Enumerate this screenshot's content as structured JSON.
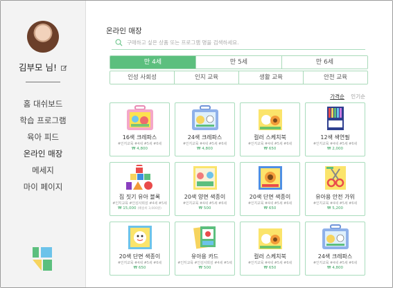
{
  "sidebar": {
    "username": "김부모 님!",
    "nav": [
      "홈 대쉬보드",
      "학습 프로그램",
      "육아 피드",
      "온라인 매장",
      "메세지",
      "마이 페이지"
    ],
    "active_nav": "온라인 매장"
  },
  "main": {
    "title": "온라인 매장",
    "search_placeholder": "구매하고 싶은 상품 또는 프로그램 명을 검색하세요.",
    "age_tabs": [
      "만 4세",
      "만 5세",
      "만 6세"
    ],
    "selected_age": "만 4세",
    "category_tabs": [
      "인성 사회성",
      "인지 교육",
      "생활 교육",
      "안전 교육"
    ],
    "sort_options": [
      "가격순",
      "인기순"
    ],
    "selected_sort": "가격순"
  },
  "products": [
    {
      "name": "16색 크레파스",
      "tags": "#인지교육 #4세 #5세 #6세",
      "price": "₩ 4,800",
      "image": "pink-crayon-case"
    },
    {
      "name": "24색 크레파스",
      "tags": "#인지교육 #4세 #5세 #6세",
      "price": "₩ 4,800",
      "image": "blue-crayon-case"
    },
    {
      "name": "컬러 스케치북",
      "tags": "#인지교육 #4세 #5세 #6세",
      "price": "₩ 650",
      "image": "sketchbook"
    },
    {
      "name": "12색 색연필",
      "tags": "#인지교육 #4세 #5세 #6세",
      "price": "₩ 2,000",
      "image": "color-pencils"
    },
    {
      "name": "집 짓기 유아 블록",
      "tags": "#인지교육 #인성사회성 #4세 #5세",
      "price": "₩ 15,000",
      "price_note": "(배송비 3,000원)",
      "image": "toy-blocks"
    },
    {
      "name": "20색 양면 색종이",
      "tags": "#인지교육 #4세 #5세 #6세",
      "price": "₩ 500",
      "image": "paper-pack"
    },
    {
      "name": "20색 단면 색종이",
      "tags": "#인지교육 #4세 #5세 #6세",
      "price": "₩ 650",
      "image": "paper-pack-blue"
    },
    {
      "name": "유아용 안전 가위",
      "tags": "#인지교육 #4세 #5세 #6세",
      "price": "₩ 5,200",
      "image": "safety-scissors"
    },
    {
      "name": "20색 단면 색종이",
      "tags": "#인지교육 #4세 #5세 #6세",
      "price": "₩ 650",
      "image": "paper-pack-yellow"
    },
    {
      "name": "유아용 카드",
      "tags": "#인지교육 #인성사회성 #4세 #5세",
      "price": "₩ 500",
      "image": "cards"
    },
    {
      "name": "컬러 스케치북",
      "tags": "#인지교육 #4세 #5세 #6세",
      "price": "₩ 650",
      "image": "sketchbook"
    },
    {
      "name": "24색 크레파스",
      "tags": "#인지교육 #4세 #5세 #6세",
      "price": "₩ 4,800",
      "image": "blue-crayon-case"
    }
  ],
  "colors": {
    "accent": "#5cbf7e",
    "border": "#a8dcbc",
    "price": "#3aa561",
    "sidebar_bg": "#f3f3f3"
  }
}
